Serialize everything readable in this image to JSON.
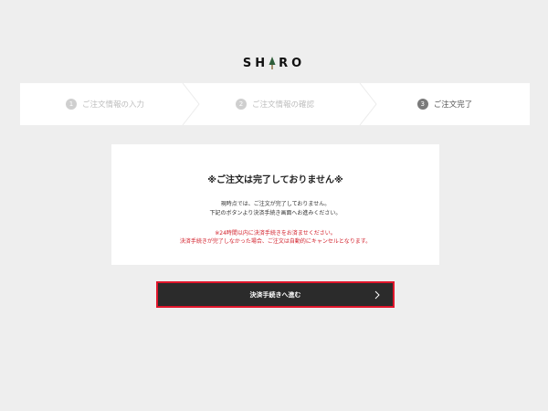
{
  "header": {
    "logo_text": "SHIRO",
    "logo_before": "SH",
    "logo_after": "RO"
  },
  "steps": [
    {
      "number": "1",
      "label": "ご注文情報の入力",
      "state": "inactive"
    },
    {
      "number": "2",
      "label": "ご注文情報の確認",
      "state": "inactive"
    },
    {
      "number": "3",
      "label": "ご注文完了",
      "state": "active"
    }
  ],
  "notice": {
    "title": "※ご注文は完了しておりません※",
    "message_line1": "現時点では、ご注文が完了しておりません。",
    "message_line2": "下記のボタンより決済手続き画面へお進みください。",
    "warning_line1": "※24時間以内に決済手続きをお済ませください。",
    "warning_line2": "決済手続きが完了しなかった場合、ご注文は自動的にキャンセルとなります。"
  },
  "action": {
    "proceed_label": "決済手続きへ進む"
  },
  "colors": {
    "background": "#eeeeee",
    "card": "#ffffff",
    "warning_text": "#d21f2a",
    "button_bg": "#2b2b2b",
    "button_outline": "#e0162b"
  },
  "icons": {
    "logo_mark": "tree-icon",
    "step_divider": "chevron-right-icon",
    "button_arrow": "chevron-right-icon"
  }
}
